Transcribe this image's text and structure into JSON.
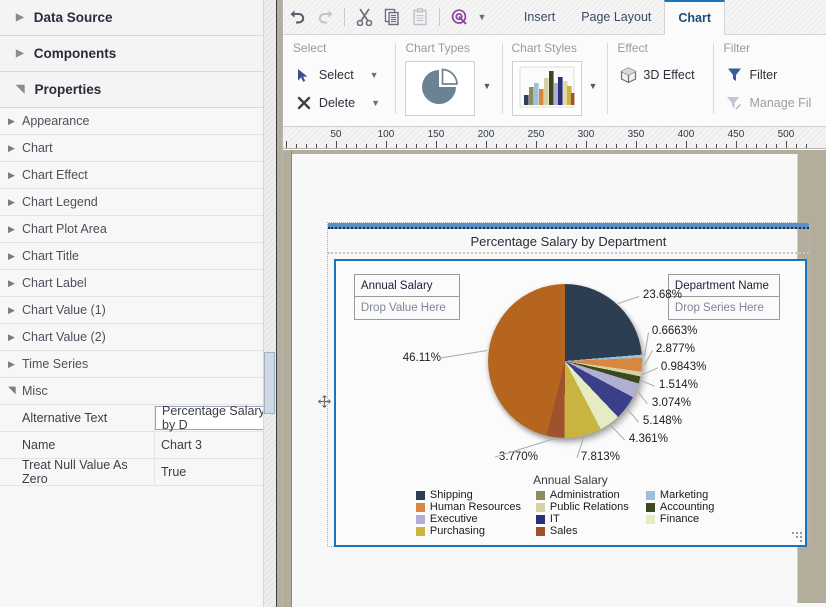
{
  "left_panel": {
    "accordions": [
      {
        "label": "Data Source",
        "expanded": false,
        "twisty": "chevron-right-icon"
      },
      {
        "label": "Components",
        "expanded": false,
        "twisty": "chevron-right-icon"
      },
      {
        "label": "Properties",
        "expanded": true,
        "twisty": "chevron-down-icon"
      }
    ],
    "property_groups": [
      {
        "label": "Appearance"
      },
      {
        "label": "Chart"
      },
      {
        "label": "Chart Effect"
      },
      {
        "label": "Chart Legend"
      },
      {
        "label": "Chart Plot Area"
      },
      {
        "label": "Chart Title"
      },
      {
        "label": "Chart Label"
      },
      {
        "label": "Chart Value (1)"
      },
      {
        "label": "Chart Value (2)"
      },
      {
        "label": "Time Series"
      }
    ],
    "misc_group_label": "Misc",
    "misc_rows": [
      {
        "key": "Alternative Text",
        "value": "Percentage Salary by D",
        "editing": true
      },
      {
        "key": "Name",
        "value": "Chart 3",
        "editing": false
      },
      {
        "key": "Treat Null Value As Zero",
        "value": "True",
        "editing": false
      }
    ]
  },
  "quick_access": {
    "icons": [
      {
        "name": "undo-icon",
        "enabled": true
      },
      {
        "name": "redo-icon",
        "enabled": false
      },
      {
        "name": "cut-icon",
        "enabled": true
      },
      {
        "name": "copy-icon",
        "enabled": true
      },
      {
        "name": "paste-icon",
        "enabled": false
      },
      {
        "name": "target-refresh-icon",
        "enabled": true
      }
    ]
  },
  "tabs": [
    {
      "label": "Insert",
      "active": false
    },
    {
      "label": "Page Layout",
      "active": false
    },
    {
      "label": "Chart",
      "active": true
    }
  ],
  "ribbon": {
    "groups": [
      {
        "title": "Select",
        "buttons": [
          {
            "label": "Select",
            "icon": "cursor-arrow-icon",
            "has_caret": true,
            "enabled": true
          },
          {
            "label": "Delete",
            "icon": "x-mark-icon",
            "has_caret": true,
            "enabled": true
          }
        ]
      },
      {
        "title": "Chart Types",
        "gallery": {
          "icon": "pie-chart-icon",
          "has_caret": true
        }
      },
      {
        "title": "Chart Styles",
        "gallery": {
          "icon": "bar-chart-icon",
          "has_caret": true
        }
      },
      {
        "title": "Effect",
        "buttons": [
          {
            "label": "3D Effect",
            "icon": "cube-icon",
            "has_caret": false,
            "enabled": true
          }
        ]
      },
      {
        "title": "Filter",
        "buttons": [
          {
            "label": "Filter",
            "icon": "funnel-icon",
            "has_caret": false,
            "enabled": true
          },
          {
            "label": "Manage Fil",
            "icon": "funnel-edit-icon",
            "has_caret": false,
            "enabled": false
          }
        ]
      }
    ]
  },
  "ruler": {
    "labels": [
      "50",
      "100",
      "150",
      "200",
      "250",
      "300",
      "350",
      "400",
      "450",
      "500"
    ]
  },
  "report": {
    "title": "Percentage Salary by Department",
    "value_dropzone": {
      "field": "Annual Salary",
      "placeholder": "Drop Value Here"
    },
    "series_dropzone": {
      "field": "Department Name",
      "placeholder": "Drop Series Here"
    },
    "axis_label": "Annual Salary"
  },
  "chart_data": {
    "type": "pie",
    "title": "Percentage Salary by Department",
    "xlabel": "Annual Salary",
    "ylabel": "",
    "legend_position": "bottom",
    "value_field": "Annual Salary",
    "series_field": "Department Name",
    "labels_suffix": "%",
    "categories": [
      "Shipping",
      "Marketing",
      "Human Resources",
      "Public Relations",
      "Accounting",
      "Executive",
      "IT",
      "Finance",
      "Purchasing",
      "Sales",
      "Administration"
    ],
    "values": [
      23.68,
      0.6663,
      2.877,
      0.9843,
      1.514,
      3.074,
      5.148,
      4.361,
      7.813,
      3.77,
      46.11
    ],
    "slices": [
      {
        "label": "Shipping",
        "value": 23.68,
        "display": "23.68%",
        "color": "#2c3e50"
      },
      {
        "label": "Marketing",
        "value": 0.6663,
        "display": "0.6663%",
        "color": "#9cc0d8"
      },
      {
        "label": "Human Resources",
        "value": 2.877,
        "display": "2.877%",
        "color": "#d9873f"
      },
      {
        "label": "Public Relations",
        "value": 0.9843,
        "display": "0.9843%",
        "color": "#d5d3a3"
      },
      {
        "label": "Accounting",
        "value": 1.514,
        "display": "1.514%",
        "color": "#3a4a1e"
      },
      {
        "label": "Executive",
        "value": 3.074,
        "display": "3.074%",
        "color": "#b0aed2"
      },
      {
        "label": "IT",
        "value": 5.148,
        "display": "5.148%",
        "color": "#3b3f87"
      },
      {
        "label": "Finance",
        "value": 4.361,
        "display": "4.361%",
        "color": "#e5ecc4"
      },
      {
        "label": "Purchasing",
        "value": 7.813,
        "display": "7.813%",
        "color": "#c9b341"
      },
      {
        "label": "Sales",
        "value": 3.77,
        "display": "3.770%",
        "color": "#a0522d"
      },
      {
        "label": "Administration",
        "value": 46.11,
        "display": "46.11%",
        "color": "#b5651d"
      }
    ],
    "legend": [
      {
        "label": "Shipping",
        "color": "#2c3e50"
      },
      {
        "label": "Administration",
        "color": "#8d8c5a"
      },
      {
        "label": "Marketing",
        "color": "#9cc0d8"
      },
      {
        "label": "Human Resources",
        "color": "#d9873f"
      },
      {
        "label": "Public Relations",
        "color": "#d5d3a3"
      },
      {
        "label": "Accounting",
        "color": "#3a4a1e"
      },
      {
        "label": "Executive",
        "color": "#b0aed2"
      },
      {
        "label": "IT",
        "color": "#2b2f7a"
      },
      {
        "label": "Finance",
        "color": "#e5ecc4"
      },
      {
        "label": "Purchasing",
        "color": "#c9b341"
      },
      {
        "label": "Sales",
        "color": "#a0522d"
      }
    ]
  },
  "colors": {
    "accent": "#1a76bc",
    "canvas": "#b3ad9b",
    "panel": "#f7f7f7"
  }
}
